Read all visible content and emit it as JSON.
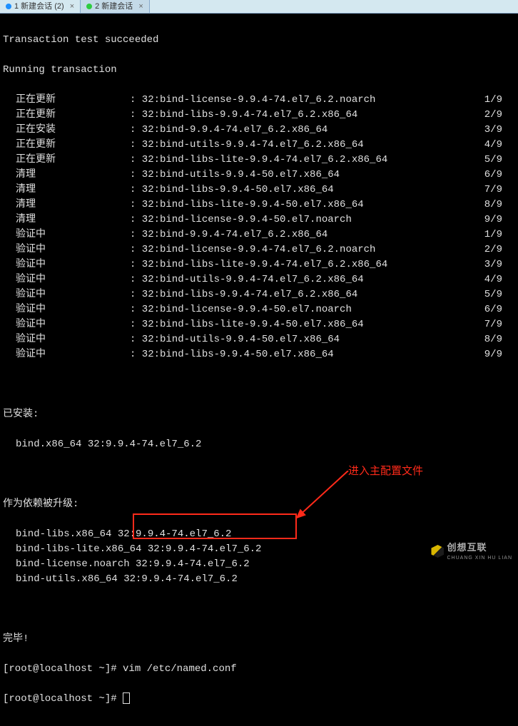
{
  "tabs": [
    {
      "dot": "blue",
      "label": "1 新建会话 (2)"
    },
    {
      "dot": "green",
      "label": "2 新建会话"
    }
  ],
  "header1": "Transaction test succeeded",
  "header2": "Running transaction",
  "rows": [
    {
      "l": "正在更新",
      "m": ": 32:bind-license-9.9.4-74.el7_6.2.noarch",
      "r": "1/9"
    },
    {
      "l": "正在更新",
      "m": ": 32:bind-libs-9.9.4-74.el7_6.2.x86_64",
      "r": "2/9"
    },
    {
      "l": "正在安装",
      "m": ": 32:bind-9.9.4-74.el7_6.2.x86_64",
      "r": "3/9"
    },
    {
      "l": "正在更新",
      "m": ": 32:bind-utils-9.9.4-74.el7_6.2.x86_64",
      "r": "4/9"
    },
    {
      "l": "正在更新",
      "m": ": 32:bind-libs-lite-9.9.4-74.el7_6.2.x86_64",
      "r": "5/9"
    },
    {
      "l": "清理",
      "m": ": 32:bind-utils-9.9.4-50.el7.x86_64",
      "r": "6/9"
    },
    {
      "l": "清理",
      "m": ": 32:bind-libs-9.9.4-50.el7.x86_64",
      "r": "7/9"
    },
    {
      "l": "清理",
      "m": ": 32:bind-libs-lite-9.9.4-50.el7.x86_64",
      "r": "8/9"
    },
    {
      "l": "清理",
      "m": ": 32:bind-license-9.9.4-50.el7.noarch",
      "r": "9/9"
    },
    {
      "l": "验证中",
      "m": ": 32:bind-9.9.4-74.el7_6.2.x86_64",
      "r": "1/9"
    },
    {
      "l": "验证中",
      "m": ": 32:bind-license-9.9.4-74.el7_6.2.noarch",
      "r": "2/9"
    },
    {
      "l": "验证中",
      "m": ": 32:bind-libs-lite-9.9.4-74.el7_6.2.x86_64",
      "r": "3/9"
    },
    {
      "l": "验证中",
      "m": ": 32:bind-utils-9.9.4-74.el7_6.2.x86_64",
      "r": "4/9"
    },
    {
      "l": "验证中",
      "m": ": 32:bind-libs-9.9.4-74.el7_6.2.x86_64",
      "r": "5/9"
    },
    {
      "l": "验证中",
      "m": ": 32:bind-license-9.9.4-50.el7.noarch",
      "r": "6/9"
    },
    {
      "l": "验证中",
      "m": ": 32:bind-libs-lite-9.9.4-50.el7.x86_64",
      "r": "7/9"
    },
    {
      "l": "验证中",
      "m": ": 32:bind-utils-9.9.4-50.el7.x86_64",
      "r": "8/9"
    },
    {
      "l": "验证中",
      "m": ": 32:bind-libs-9.9.4-50.el7.x86_64",
      "r": "9/9"
    }
  ],
  "installed_header": "已安装:",
  "installed_line": "bind.x86_64 32:9.9.4-74.el7_6.2",
  "dep_header": "作为依赖被升级:",
  "dep_lines": [
    "bind-libs.x86_64 32:9.9.4-74.el7_6.2",
    "bind-libs-lite.x86_64 32:9.9.4-74.el7_6.2",
    "bind-license.noarch 32:9.9.4-74.el7_6.2",
    "bind-utils.x86_64 32:9.9.4-74.el7_6.2"
  ],
  "done": "完毕!",
  "prompt1": "[root@localhost ~]# vim /etc/named.conf",
  "prompt2": "[root@localhost ~]# ",
  "annotation": "进入主配置文件",
  "watermark_main": "创想互联",
  "watermark_sub": "CHUANG XIN HU LIAN"
}
